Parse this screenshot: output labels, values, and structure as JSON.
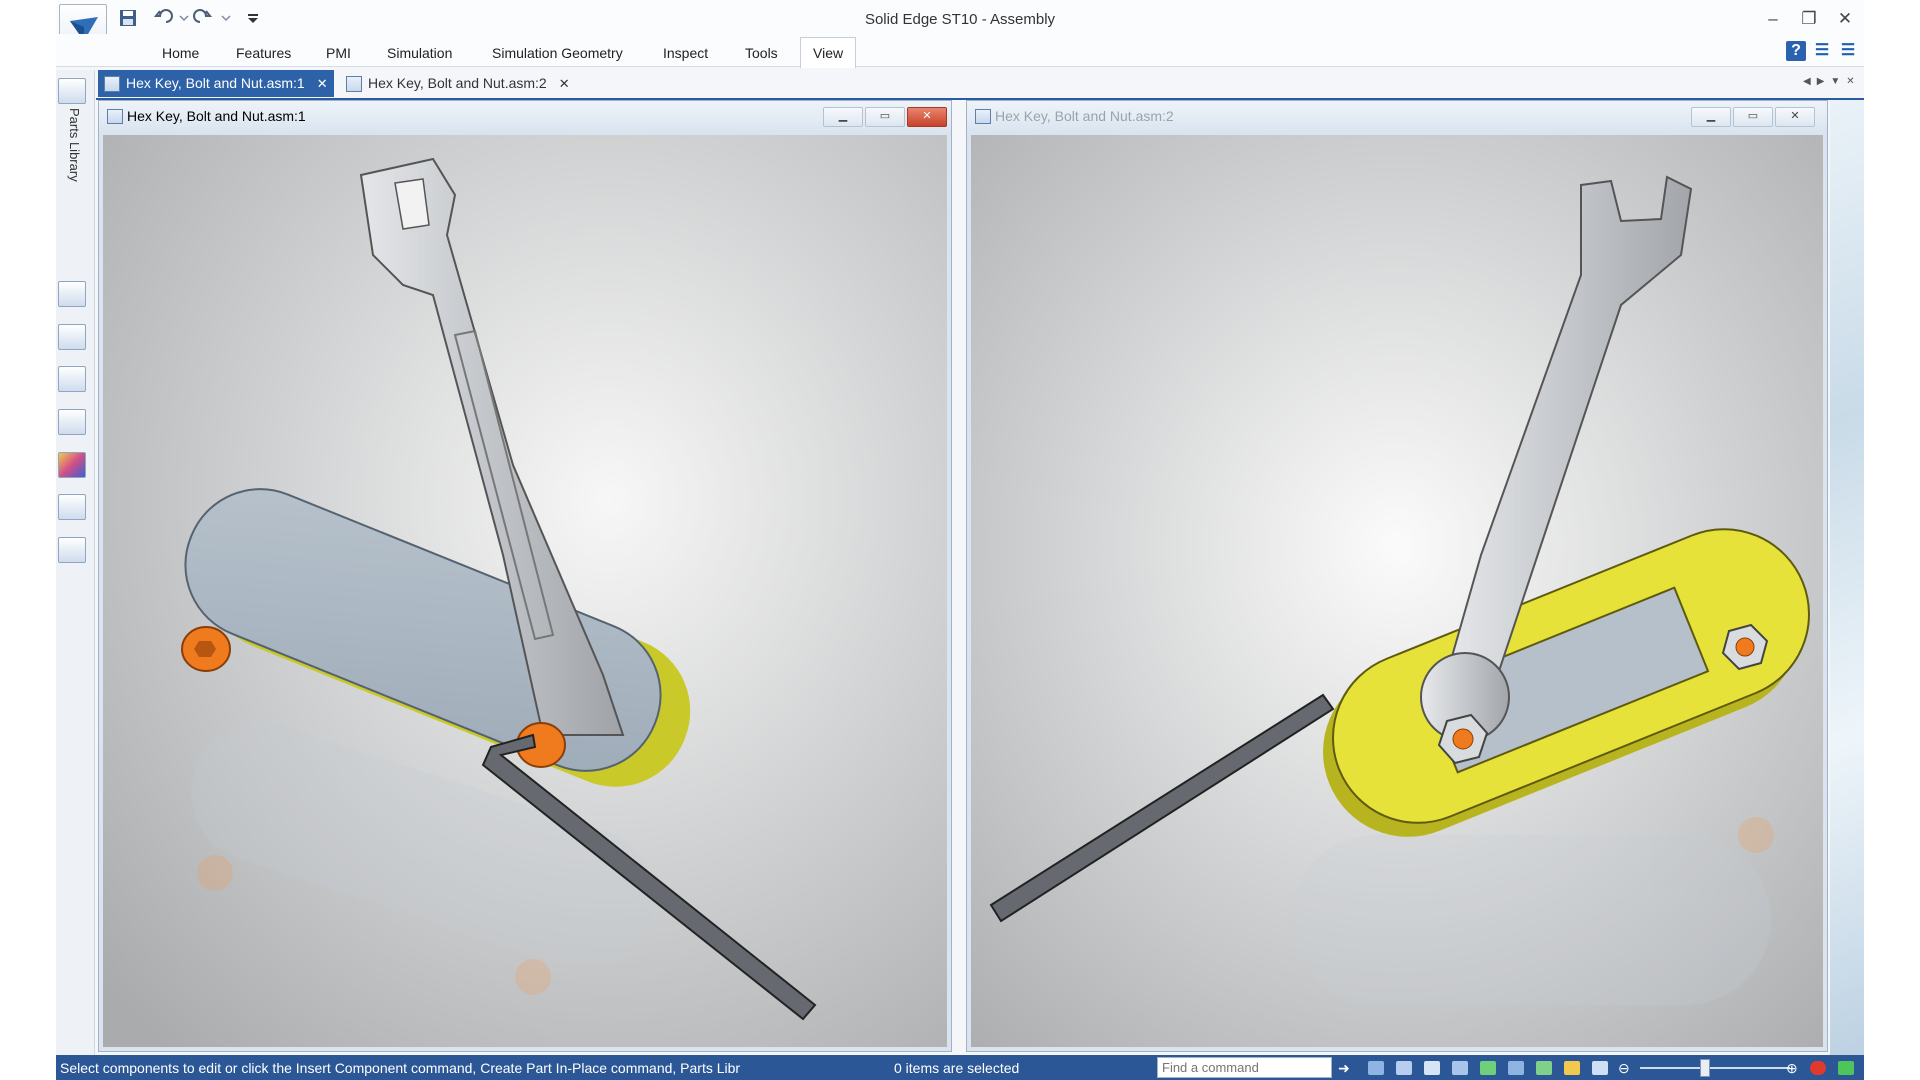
{
  "app": {
    "title": "Solid Edge ST10 - Assembly"
  },
  "quick_access": [
    "save-icon",
    "undo-icon",
    "redo-icon",
    "customize-icon"
  ],
  "ribbon": {
    "tabs": [
      "Home",
      "Features",
      "PMI",
      "Simulation",
      "Simulation Geometry",
      "Inspect",
      "Tools",
      "View"
    ],
    "active_tab": "View"
  },
  "doc_tabs": [
    {
      "label": "Hex Key, Bolt and Nut.asm:1",
      "active": true
    },
    {
      "label": "Hex Key, Bolt and Nut.asm:2",
      "active": false
    }
  ],
  "side_panel": {
    "label": "Parts Library"
  },
  "windows": [
    {
      "title": "Hex Key, Bolt and Nut.asm:1",
      "active": true
    },
    {
      "title": "Hex Key, Bolt and Nut.asm:2",
      "active": false
    }
  ],
  "status": {
    "message": "Select components to edit or click the Insert Component command, Create Part In-Place command, Parts Libr",
    "selection": "0 items are selected",
    "find_placeholder": "Find a command"
  },
  "colors": {
    "accent": "#2b5797",
    "part_yellow": "#e6e23a",
    "nut_orange": "#f07a1e",
    "wrench_gray": "#c9ccd1"
  }
}
